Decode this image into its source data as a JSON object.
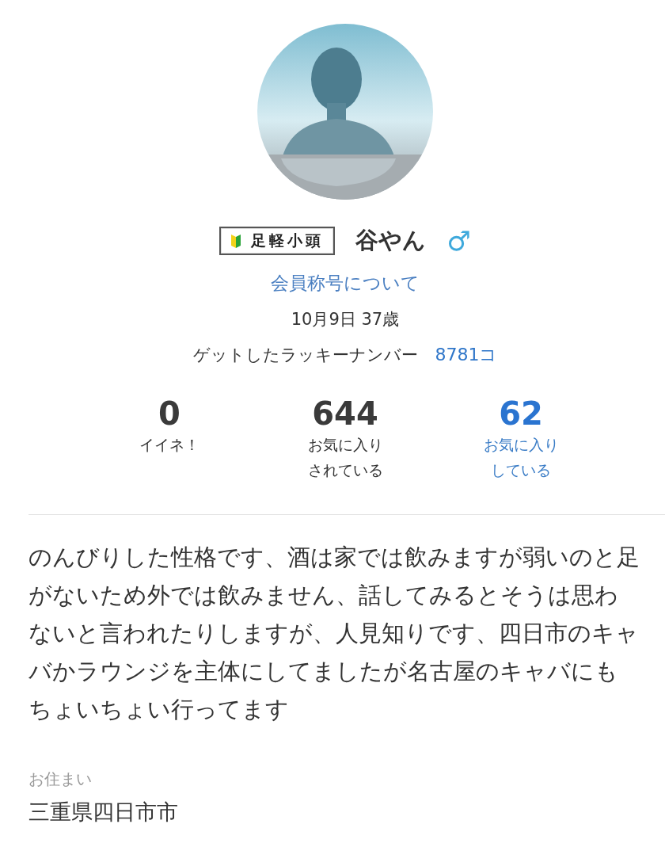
{
  "profile": {
    "rank_badge": "足軽小頭",
    "name": "谷やん",
    "gender_symbol": "♂",
    "rank_link": "会員称号について",
    "birthday_age": "10月9日 37歳",
    "lucky_label": "ゲットしたラッキーナンバー",
    "lucky_value": "8781コ"
  },
  "stats": [
    {
      "value": "0",
      "label_lines": [
        "イイネ！"
      ],
      "link": false
    },
    {
      "value": "644",
      "label_lines": [
        "お気に入り",
        "されている"
      ],
      "link": false
    },
    {
      "value": "62",
      "label_lines": [
        "お気に入り",
        "している"
      ],
      "link": true
    }
  ],
  "bio": "のんびりした性格です、酒は家では飲みますが弱いのと足がないため外では飲みません、話してみるとそうは思わないと言われたりしますが、人見知りです、四日市のキャバかラウンジを主体にしてましたが名古屋のキャバにもちょいちょい行ってます",
  "residence": {
    "label": "お住まい",
    "value": "三重県四日市市"
  }
}
